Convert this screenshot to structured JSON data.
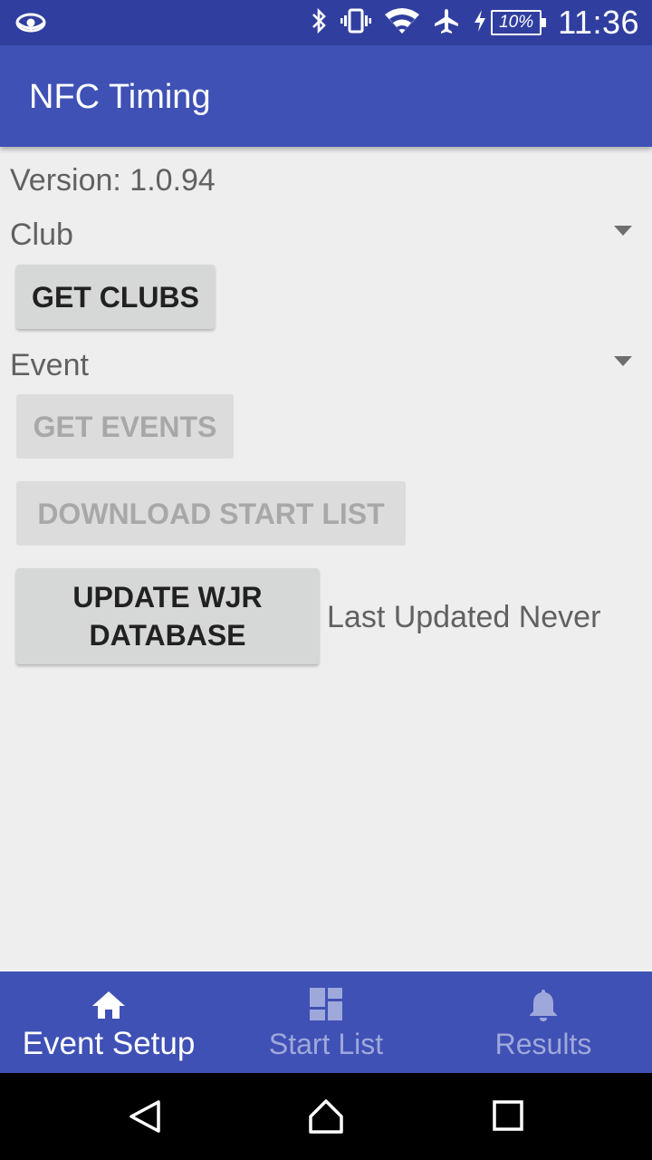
{
  "status_bar": {
    "battery": "10%",
    "time": "11:36",
    "icons": [
      "eye-icon",
      "bluetooth-icon",
      "vibrate-icon",
      "wifi-icon",
      "airplane-icon",
      "charging-icon",
      "battery-icon"
    ]
  },
  "app_bar": {
    "title": "NFC Timing"
  },
  "content": {
    "version": "Version: 1.0.94",
    "club_label": "Club",
    "get_clubs": "GET CLUBS",
    "event_label": "Event",
    "get_events": "GET EVENTS",
    "download_start_list": "DOWNLOAD START LIST",
    "update_db_line1": "UPDATE WJR",
    "update_db_line2": "DATABASE",
    "last_updated": "Last Updated Never"
  },
  "bottom_nav": {
    "items": [
      {
        "label": "Event Setup",
        "icon": "home-icon",
        "active": true
      },
      {
        "label": "Start List",
        "icon": "dashboard-icon",
        "active": false
      },
      {
        "label": "Results",
        "icon": "bell-icon",
        "active": false
      }
    ]
  },
  "colors": {
    "primary": "#3F51B5",
    "primary_dark": "#303F9F",
    "background": "#EEEEEE",
    "button": "#D6D7D7",
    "inactive_nav": "#9FA8DA"
  }
}
